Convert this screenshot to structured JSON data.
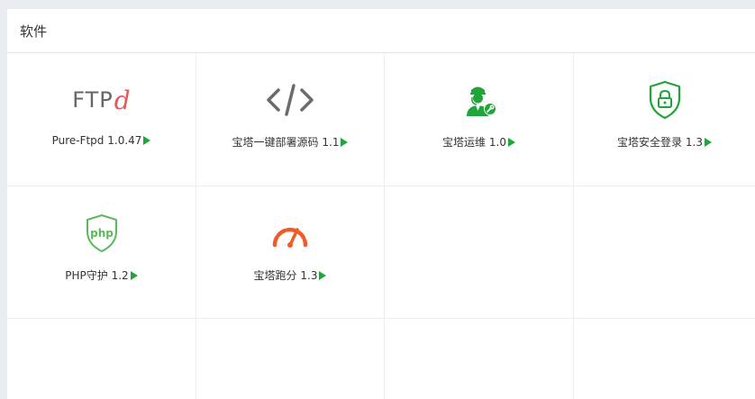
{
  "panel": {
    "title": "软件"
  },
  "plugins": [
    {
      "name": "Pure-Ftpd",
      "version": "1.0.47",
      "icon": "ftpd-logo-icon",
      "logo_text": "FTP",
      "logo_suffix": "d"
    },
    {
      "name": "宝塔一键部署源码",
      "version": "1.1",
      "icon": "code-brackets-icon"
    },
    {
      "name": "宝塔运维",
      "version": "1.0",
      "icon": "operator-wrench-icon"
    },
    {
      "name": "宝塔安全登录",
      "version": "1.3",
      "icon": "shield-lock-icon"
    },
    {
      "name": "PHP守护",
      "version": "1.2",
      "icon": "php-shield-icon",
      "logo_text": "php"
    },
    {
      "name": "宝塔跑分",
      "version": "1.3",
      "icon": "speedometer-icon"
    }
  ],
  "colors": {
    "accent_green": "#20a53a",
    "logo_red": "#e05a5a",
    "speedometer_orange": "#f15a29",
    "text": "#333333"
  }
}
